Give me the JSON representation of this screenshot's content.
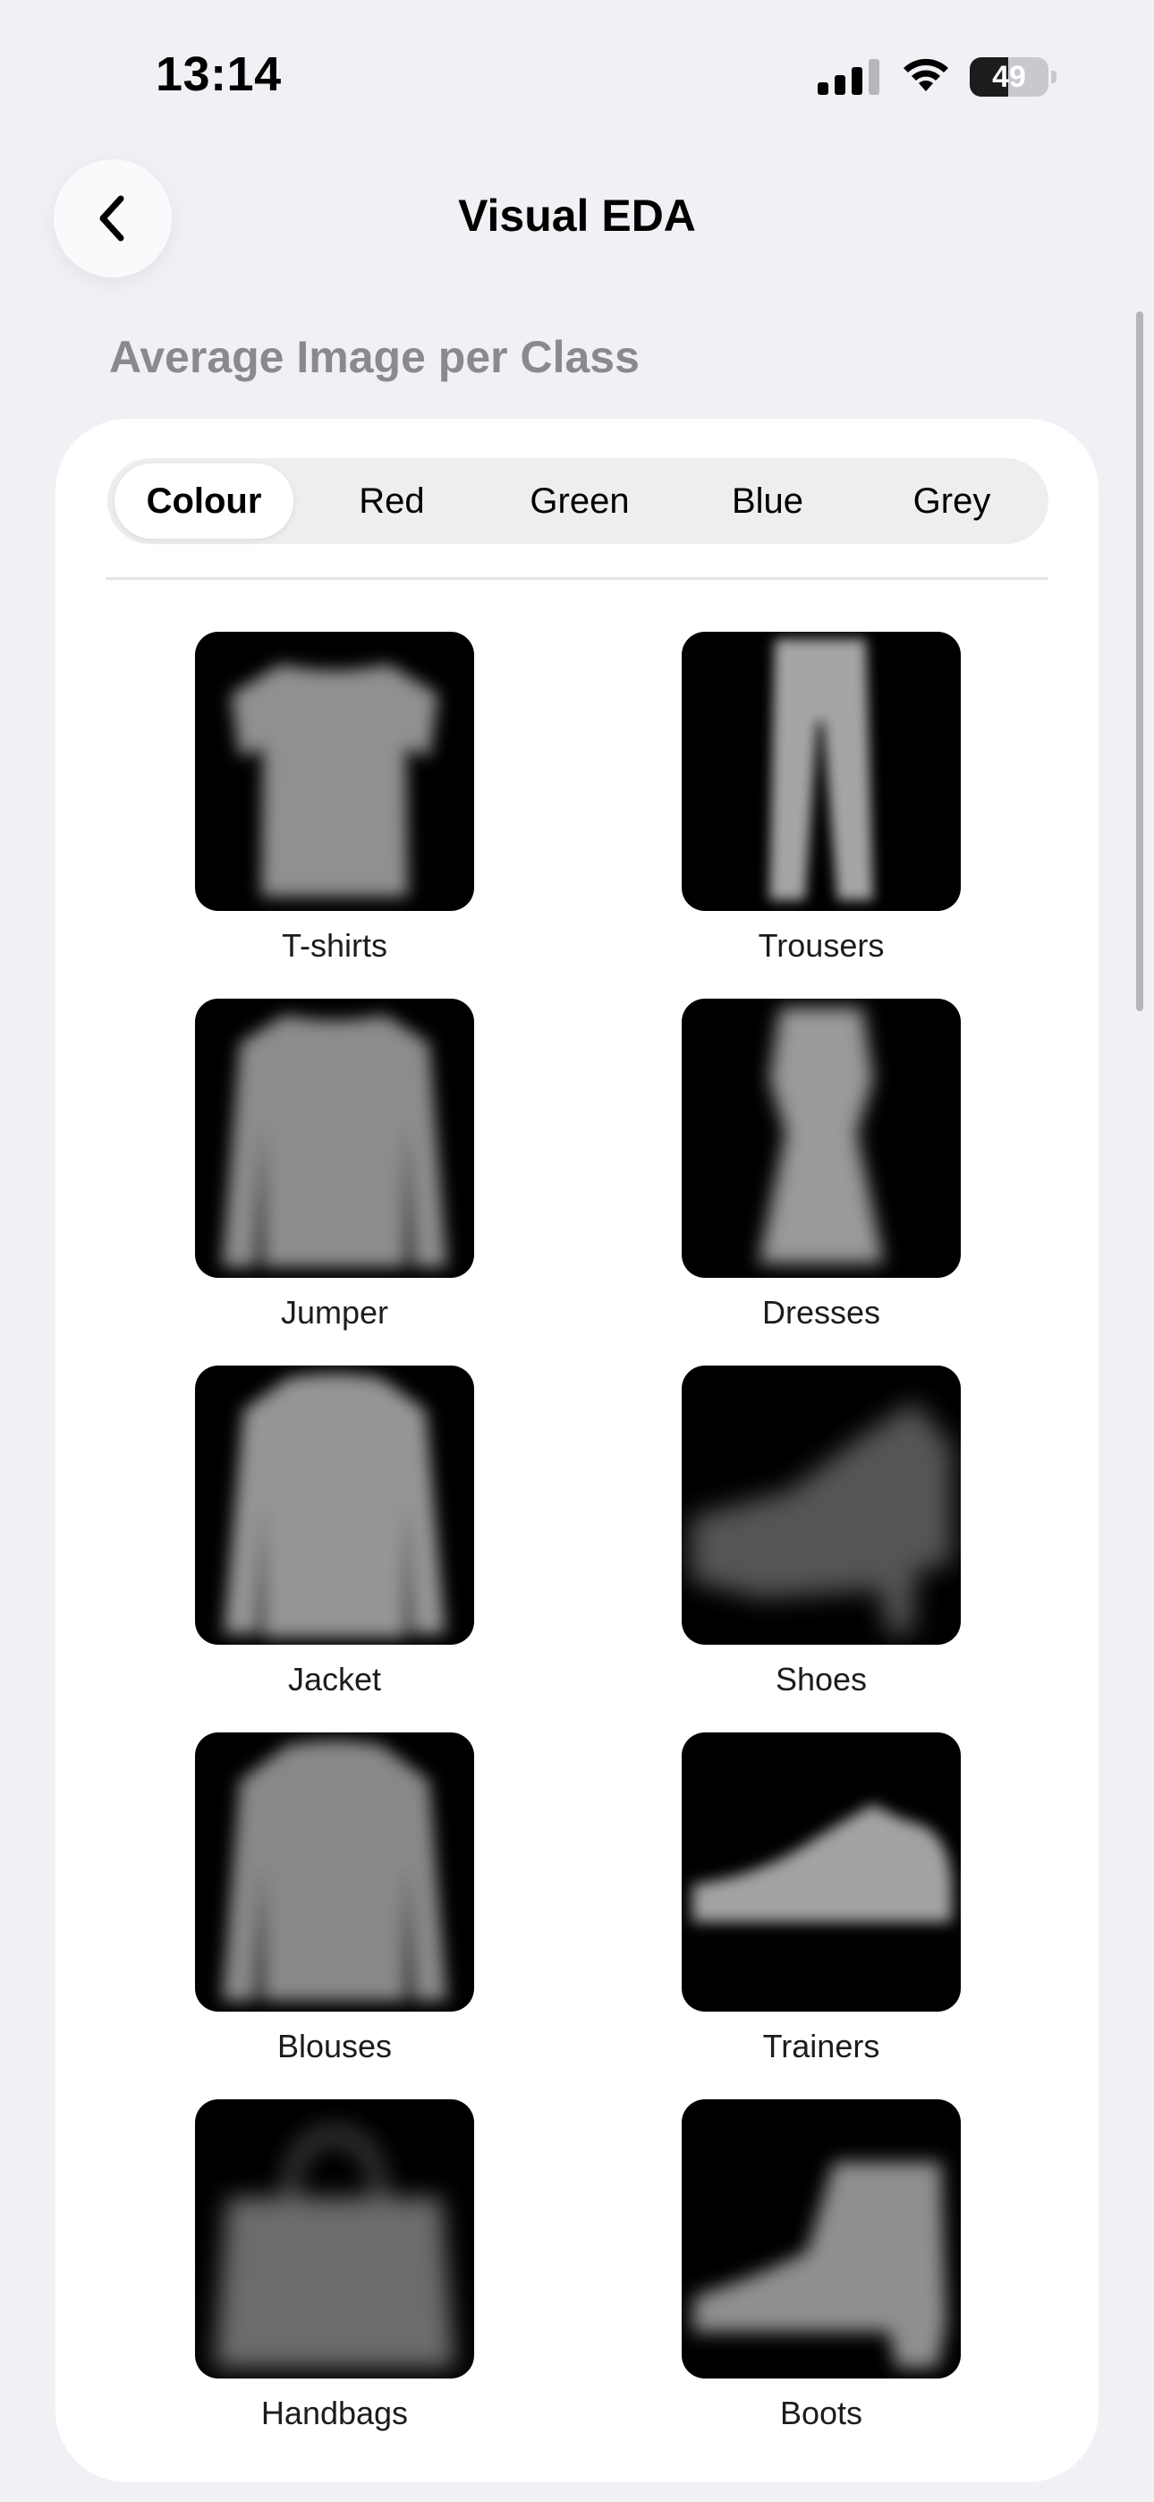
{
  "status_bar": {
    "time": "13:14",
    "battery": "49",
    "battery_level": 0.49
  },
  "nav": {
    "title": "Visual EDA",
    "back_icon": "chevron-left-icon"
  },
  "section": {
    "title": "Average Image per Class"
  },
  "segments": [
    {
      "label": "Colour",
      "selected": true
    },
    {
      "label": "Red",
      "selected": false
    },
    {
      "label": "Green",
      "selected": false
    },
    {
      "label": "Blue",
      "selected": false
    },
    {
      "label": "Grey",
      "selected": false
    }
  ],
  "classes": [
    {
      "label": "T-shirts",
      "icon": "tshirt-average-image"
    },
    {
      "label": "Trousers",
      "icon": "trousers-average-image"
    },
    {
      "label": "Jumper",
      "icon": "jumper-average-image"
    },
    {
      "label": "Dresses",
      "icon": "dress-average-image"
    },
    {
      "label": "Jacket",
      "icon": "jacket-average-image"
    },
    {
      "label": "Shoes",
      "icon": "shoe-average-image"
    },
    {
      "label": "Blouses",
      "icon": "blouse-average-image"
    },
    {
      "label": "Trainers",
      "icon": "trainer-average-image"
    },
    {
      "label": "Handbags",
      "icon": "handbag-average-image"
    },
    {
      "label": "Boots",
      "icon": "boot-average-image"
    }
  ]
}
